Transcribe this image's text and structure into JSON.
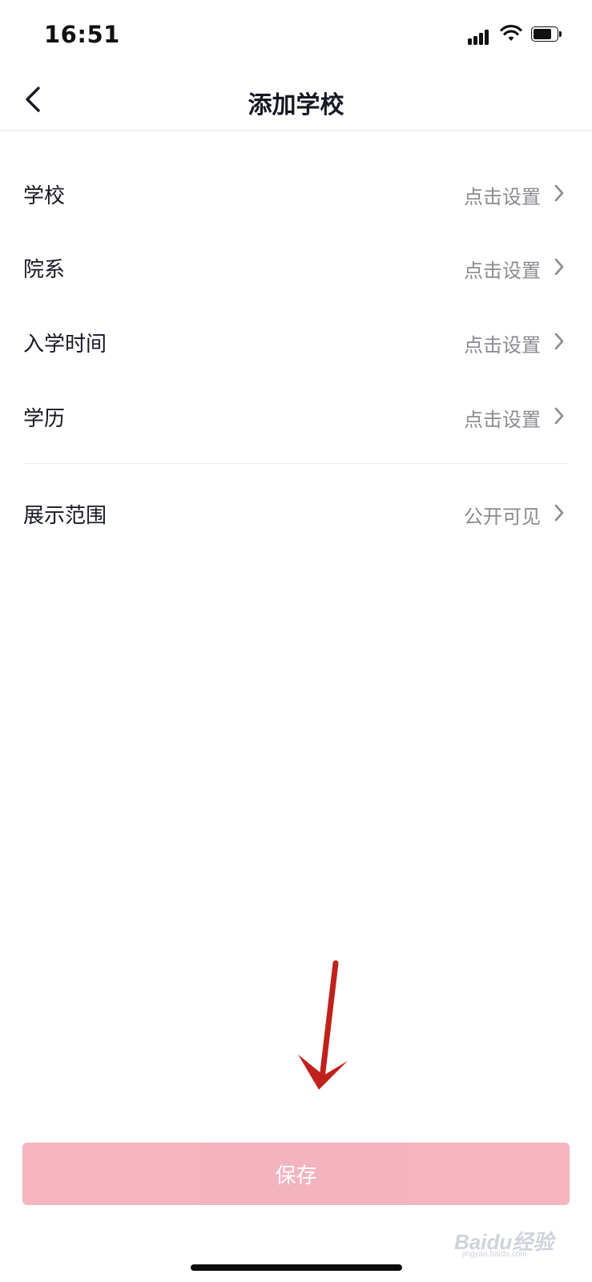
{
  "status_bar": {
    "time": "16:51",
    "signal_icon": "cellular-signal-icon",
    "wifi_icon": "wifi-icon",
    "battery_icon": "battery-icon"
  },
  "nav": {
    "title": "添加学校",
    "back_icon": "chevron-left-icon"
  },
  "rows": [
    {
      "label": "学校",
      "value": "点击设置"
    },
    {
      "label": "院系",
      "value": "点击设置"
    },
    {
      "label": "入学时间",
      "value": "点击设置"
    },
    {
      "label": "学历",
      "value": "点击设置"
    },
    {
      "label": "展示范围",
      "value": "公开可见"
    }
  ],
  "save_button": {
    "label": "保存"
  },
  "watermark": {
    "main": "Baidu经验",
    "sub": "jingyan.baidu.com"
  },
  "colors": {
    "accent_disabled": "#f3b1bd",
    "annotation_arrow": "#c0221b",
    "value_text": "#8a8b91"
  }
}
